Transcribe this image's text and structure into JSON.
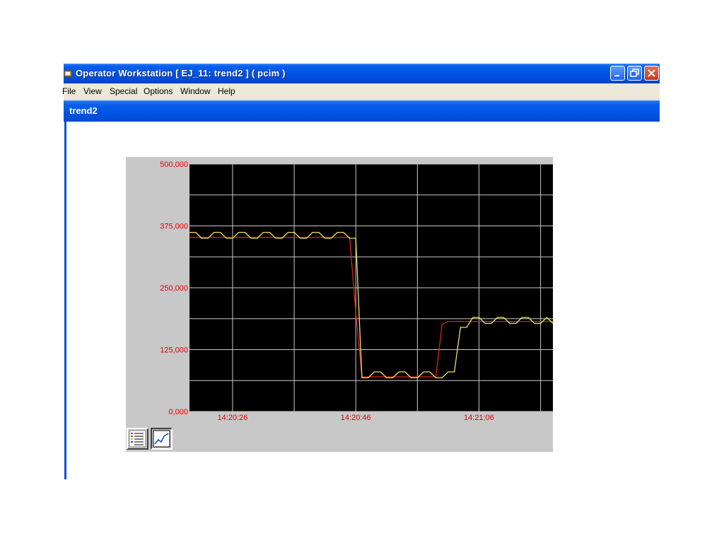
{
  "window": {
    "title": "Operator Workstation [ EJ_11: trend2 ]  ( pcim )",
    "minimize_icon": "minimize-icon",
    "restore_icon": "restore-icon",
    "close_icon": "close-icon"
  },
  "menu": {
    "items": [
      "File",
      "View",
      "Special",
      "Options",
      "Window",
      "Help"
    ]
  },
  "child_window": {
    "title": "trend2"
  },
  "toolbar": {
    "legend_button_icon": "legend-list-icon",
    "chart_button_icon": "trend-chart-icon"
  },
  "colors": {
    "title_bar": "#0055e5",
    "plot_background": "#000000",
    "grid": "#c8c8c8",
    "axis_labels": "#e00000",
    "series_pv": "#f0e060",
    "series_sp": "#e02020"
  },
  "chart_data": {
    "type": "line",
    "ylim": [
      0,
      500000
    ],
    "yticks": [
      "0,000",
      "125,000",
      "250,000",
      "375,000",
      "500,000"
    ],
    "xlim_seconds": [
      "14:20:19",
      "14:21:18"
    ],
    "xtick_labels": [
      "14:20:26",
      "14:20:46",
      "14:21:06"
    ],
    "grid": true,
    "series": [
      {
        "color": "#f0e060",
        "x": [
          "14:20:19",
          "14:20:20",
          "14:20:21",
          "14:20:22",
          "14:20:23",
          "14:20:24",
          "14:20:25",
          "14:20:26",
          "14:20:27",
          "14:20:28",
          "14:20:29",
          "14:20:30",
          "14:20:31",
          "14:20:32",
          "14:20:33",
          "14:20:34",
          "14:20:35",
          "14:20:36",
          "14:20:37",
          "14:20:38",
          "14:20:39",
          "14:20:40",
          "14:20:41",
          "14:20:42",
          "14:20:43",
          "14:20:44",
          "14:20:45",
          "14:20:46",
          "14:20:47",
          "14:20:48",
          "14:20:49",
          "14:20:50",
          "14:20:51",
          "14:20:52",
          "14:20:53",
          "14:20:54",
          "14:20:55",
          "14:20:56",
          "14:20:57",
          "14:20:58",
          "14:20:59",
          "14:21:00",
          "14:21:01",
          "14:21:02",
          "14:21:03",
          "14:21:04",
          "14:21:05",
          "14:21:06",
          "14:21:07",
          "14:21:08",
          "14:21:09",
          "14:21:10",
          "14:21:11",
          "14:21:12",
          "14:21:13",
          "14:21:14",
          "14:21:15",
          "14:21:16",
          "14:21:17",
          "14:21:18"
        ],
        "values": [
          362000,
          362000,
          350000,
          350000,
          362000,
          362000,
          350000,
          350000,
          362000,
          362000,
          350000,
          350000,
          362000,
          362000,
          350000,
          350000,
          362000,
          362000,
          350000,
          350000,
          362000,
          362000,
          350000,
          350000,
          362000,
          362000,
          350000,
          350000,
          68000,
          68000,
          80000,
          80000,
          68000,
          68000,
          80000,
          80000,
          68000,
          68000,
          80000,
          80000,
          68000,
          68000,
          80000,
          80000,
          170000,
          170000,
          190000,
          190000,
          178000,
          178000,
          190000,
          190000,
          178000,
          178000,
          190000,
          190000,
          178000,
          178000,
          190000,
          178000
        ]
      },
      {
        "color": "#e02020",
        "x": [
          "14:20:19",
          "14:20:45",
          "14:20:46",
          "14:20:47",
          "14:20:58",
          "14:20:59",
          "14:21:00",
          "14:21:01",
          "14:21:18"
        ],
        "values": [
          352000,
          352000,
          200000,
          70000,
          70000,
          70000,
          176000,
          182000,
          182000
        ]
      }
    ]
  }
}
